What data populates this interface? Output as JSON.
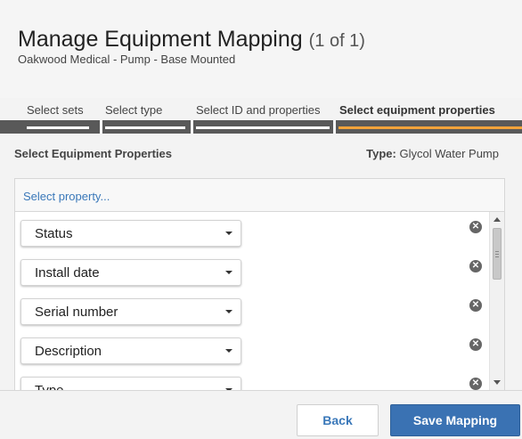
{
  "header": {
    "title": "Manage Equipment Mapping",
    "count": "(1 of 1)",
    "subtitle": "Oakwood Medical - Pump - Base Mounted"
  },
  "steps": [
    {
      "label": "Select sets",
      "active": false
    },
    {
      "label": "Select type",
      "active": false
    },
    {
      "label": "Select ID and properties",
      "active": false
    },
    {
      "label": "Select equipment properties",
      "active": true
    }
  ],
  "section": {
    "title": "Select Equipment Properties",
    "type_label": "Type:",
    "type_value": "Glycol Water Pump"
  },
  "select_property": {
    "placeholder": "Select property..."
  },
  "properties": [
    {
      "label": "Status"
    },
    {
      "label": "Install date"
    },
    {
      "label": "Serial number"
    },
    {
      "label": "Description"
    },
    {
      "label": "Type"
    }
  ],
  "footer": {
    "back_label": "Back",
    "save_label": "Save Mapping"
  },
  "colors": {
    "accent": "#f2a33a",
    "primary": "#3a72b3",
    "link": "#3a78b9"
  }
}
